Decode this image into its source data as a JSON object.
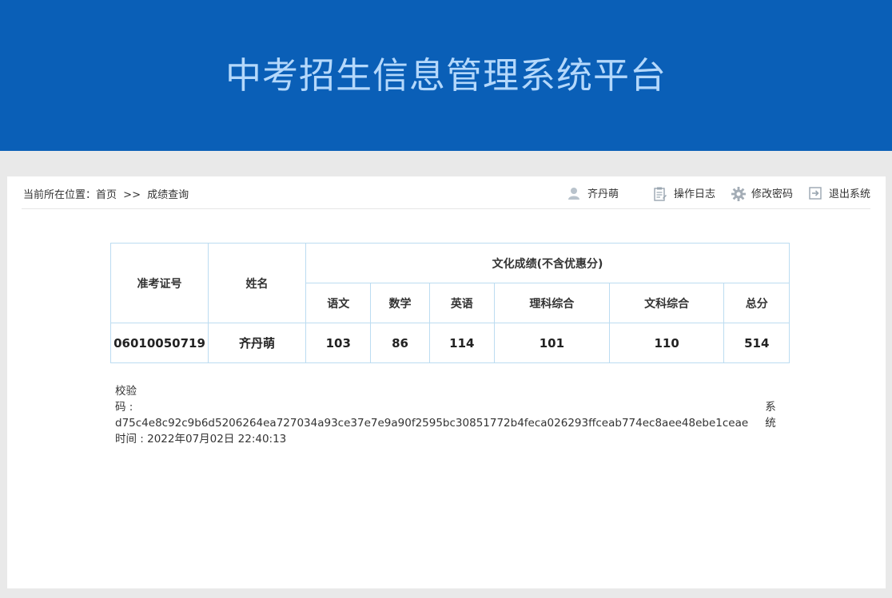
{
  "header": {
    "title": "中考招生信息管理系统平台"
  },
  "breadcrumb": {
    "prefix": "当前所在位置：",
    "home": "首页",
    "sep": ">>",
    "current": "成绩查询"
  },
  "toolbar": {
    "user": "齐丹萌",
    "log": "操作日志",
    "password": "修改密码",
    "logout": "退出系统"
  },
  "table": {
    "col_id": "准考证号",
    "col_name": "姓名",
    "group": "文化成绩(不含优惠分)",
    "subjects": [
      "语文",
      "数学",
      "英语",
      "理科综合",
      "文科综合",
      "总分"
    ],
    "row": {
      "id": "06010050719",
      "name": "齐丹萌",
      "scores": [
        "103",
        "86",
        "114",
        "101",
        "110",
        "514"
      ]
    }
  },
  "verify": {
    "label": "校验",
    "code_line": "码 : d75c4e8c92c9b6d5206264ea727034a93ce37e7e9a90f2595bc30851772b4feca026293ffceab774ec8aee48ebe1ceae",
    "sys_label": "系统",
    "time_line": "时间 : 2022年07月02日 22:40:13"
  },
  "colors": {
    "header_bg": "#0a5fb7",
    "title": "#b4d8fb",
    "border": "#bcdcf1"
  }
}
